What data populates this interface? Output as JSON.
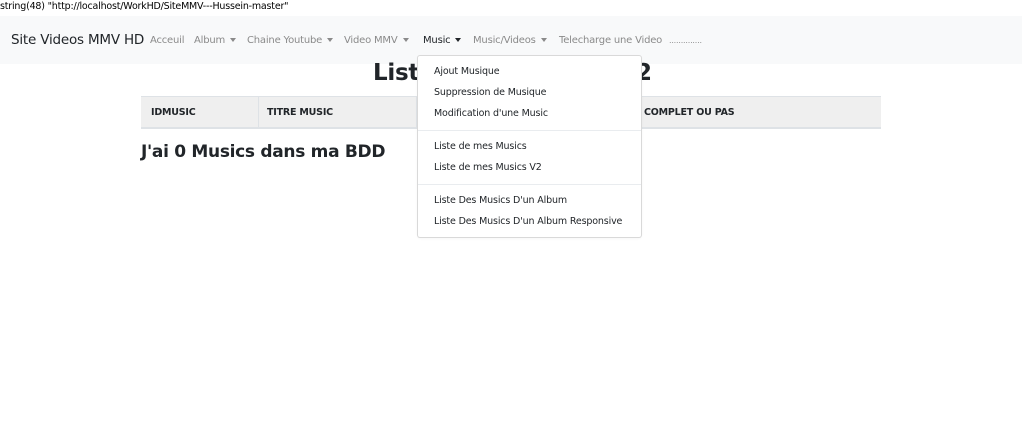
{
  "debug": {
    "text": "string(48) \"http://localhost/WorkHD/SiteMMV---Hussein-master\""
  },
  "navbar": {
    "brand": "Site Videos MMV HD",
    "items": [
      {
        "label": "Acceuil",
        "has_caret": false
      },
      {
        "label": "Album",
        "has_caret": true
      },
      {
        "label": "Chaine Youtube",
        "has_caret": true
      },
      {
        "label": "Video MMV",
        "has_caret": true
      },
      {
        "label": "Music",
        "has_caret": true,
        "active": true
      },
      {
        "label": "Music/Videos",
        "has_caret": true
      },
      {
        "label": "Telecharge une Video",
        "has_caret": false
      },
      {
        "label": "..............",
        "has_caret": false
      }
    ]
  },
  "page": {
    "title_left": "Liste",
    "title_right": "2",
    "count_text": "J'ai 0 Musics dans ma BDD"
  },
  "table": {
    "headers": [
      "IDMUSIC",
      "TITRE MUSIC",
      "COMPLET OU PAS"
    ]
  },
  "dropdown": {
    "groups": [
      [
        "Ajout Musique",
        "Suppression de Musique",
        "Modification d'une Music"
      ],
      [
        "Liste de mes Musics",
        "Liste de mes Musics V2"
      ],
      [
        "Liste Des Musics D'un Album",
        "Liste Des Musics D'un Album Responsive"
      ]
    ]
  },
  "colors": {
    "navbar_bg": "#f8f9fa",
    "nav_muted": "#8a8a8a",
    "nav_active": "#212529",
    "table_head_bg": "#efefef"
  }
}
